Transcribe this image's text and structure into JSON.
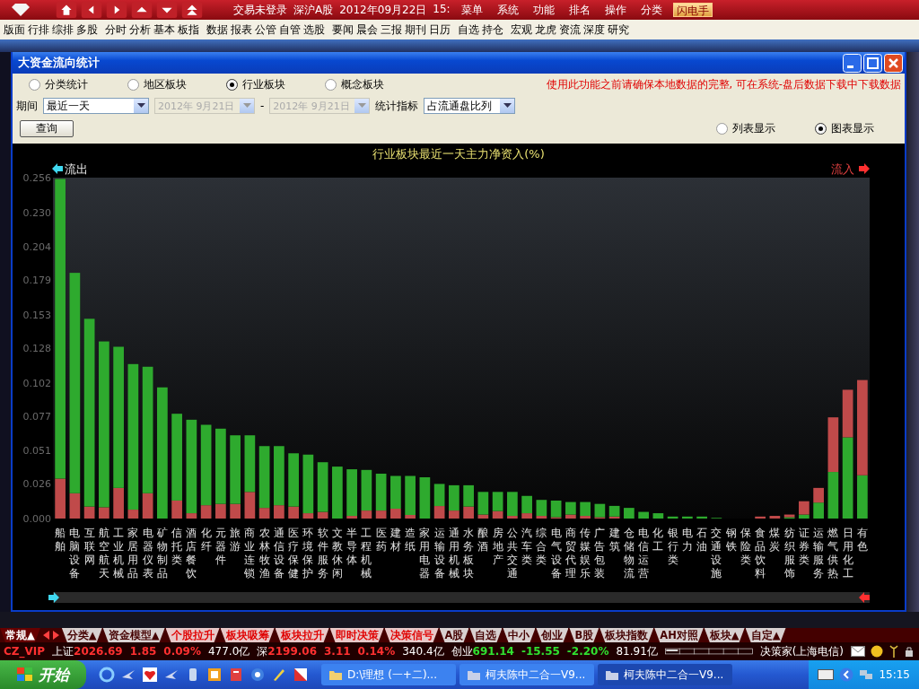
{
  "top_bar": {
    "status": [
      "交易未登录",
      "深沪A股",
      "2012年09月22日",
      "15:"
    ],
    "menus": [
      "菜单",
      "系统",
      "功能",
      "排名",
      "操作",
      "分类"
    ],
    "quick_button": "闪电手"
  },
  "toolbar": [
    [
      "版面",
      "行排",
      "综排",
      "多股"
    ],
    [
      "分时",
      "分析",
      "基本",
      "板指"
    ],
    [
      "数据",
      "报表",
      "公管",
      "自管",
      "选股"
    ],
    [
      "要闻",
      "晨会",
      "三报",
      "期刊",
      "日历"
    ],
    [
      "自选",
      "持仓"
    ],
    [
      "宏观",
      "龙虎",
      "资流",
      "深度",
      "研究"
    ]
  ],
  "dialog": {
    "title": "大资金流向统计",
    "categories": [
      {
        "label": "分类统计",
        "selected": false
      },
      {
        "label": "地区板块",
        "selected": false
      },
      {
        "label": "行业板块",
        "selected": true
      },
      {
        "label": "概念板块",
        "selected": false
      }
    ],
    "notice": "使用此功能之前请确保本地数据的完整, 可在系统-盘后数据下载中下载数据",
    "period_label": "期间",
    "period": "最近一天",
    "date_from": {
      "value": "2012年  9月21日",
      "disabled": true
    },
    "date_sep": "-",
    "date_to": {
      "value": "2012年  9月21日",
      "disabled": true
    },
    "indicator_label": "统计指标",
    "indicator": "占流通盘比列",
    "query_button": "查询",
    "outflow_label": "流出",
    "inflow_label": "流入",
    "views": [
      {
        "label": "列表显示",
        "selected": false
      },
      {
        "label": "图表显示",
        "selected": true
      }
    ],
    "chart_data": {
      "type": "bar",
      "title": "行业板块最近一天主力净资入(%)",
      "categories": [
        "船舶",
        "电脑设备",
        "互联网",
        "航空航天",
        "工业机械",
        "家居用品",
        "电器仪表",
        "矿物制品",
        "信托类",
        "酒店餐饮",
        "化纤",
        "元器件",
        "旅游",
        "商业连锁",
        "农林牧渔",
        "通信设备",
        "医疗保健",
        "环境保护",
        "软件服务",
        "文教休闲",
        "半导体",
        "工程机械",
        "医药",
        "建材",
        "造纸",
        "家用电器",
        "运输设备",
        "通用机械",
        "水务板块",
        "酿酒",
        "房地产",
        "公共交通",
        "汽车类",
        "综合类",
        "电气设备",
        "商贸代理",
        "传媒娱乐",
        "广告包装",
        "建筑",
        "仓储物流",
        "电信运营",
        "化工",
        "银行类",
        "电力",
        "石油",
        "交通设施",
        "钢铁",
        "保险类",
        "食品饮料",
        "煤炭",
        "纺织服饰",
        "证券类",
        "运输服务",
        "燃气供热",
        "日用化工",
        "有色"
      ],
      "stacked": true,
      "series": [
        {
          "color": "#2eaa2e",
          "values": [
            null,
            null,
            null,
            null,
            null,
            null,
            null,
            null,
            null,
            null,
            null,
            null,
            null,
            null,
            null,
            null,
            null,
            null,
            null,
            null,
            null,
            null,
            null,
            null,
            null,
            null,
            null,
            null,
            null,
            null,
            null,
            null,
            null,
            null,
            null,
            null,
            null,
            null,
            null,
            null,
            null,
            null,
            null,
            null,
            null,
            null,
            null,
            null,
            null,
            null,
            0.001,
            0.003,
            0.012,
            0.035,
            0.061,
            0.0325
          ]
        },
        {
          "color": "#c04a4a",
          "values": [
            0.03,
            0.019,
            0.009,
            0.0085,
            0.023,
            0.0067,
            0.019,
            0,
            0.0135,
            0.004,
            0.01,
            0.011,
            0.011,
            0.02,
            0.008,
            0.01,
            0.009,
            0.004,
            0.005,
            0,
            0.002,
            0.006,
            0.006,
            0.0074,
            0.0027,
            0,
            0.0094,
            0.006,
            0.009,
            0.003,
            0.0056,
            0.002,
            0.004,
            0.002,
            0.001,
            0.003,
            0.002,
            0.001,
            0.0015,
            0,
            0,
            0,
            0,
            0,
            0,
            0,
            0,
            0,
            0.0015,
            0.002,
            0.002,
            0.01,
            0.011,
            0.041,
            0.0357,
            0.0715
          ]
        },
        {
          "color": "#2eaa2e",
          "values": [
            0.225,
            0.1655,
            0.141,
            0.1245,
            0.106,
            0.1093,
            0.095,
            0.0985,
            0.0652,
            0.0702,
            0.0604,
            0.0565,
            0.0515,
            0.0425,
            0.0464,
            0.0444,
            0.04,
            0.044,
            0.0373,
            0.039,
            0.035,
            0.0305,
            0.0277,
            0.0246,
            0.0293,
            0.031,
            0.0166,
            0.019,
            0.016,
            0.017,
            0.0144,
            0.018,
            0.013,
            0.012,
            0.0125,
            0.0094,
            0.0104,
            0.01,
            0.008,
            0.008,
            0.005,
            0.004,
            0.0015,
            0.0015,
            0.0015,
            0.0005,
            0,
            0,
            null,
            null,
            null,
            null,
            null,
            null,
            null,
            null
          ]
        }
      ],
      "ylim": [
        0,
        0.256
      ],
      "yticks": [
        {
          "value": 0,
          "label": "0.000"
        },
        {
          "value": 0.026,
          "label": "0.026"
        },
        {
          "value": 0.051,
          "label": "0.051"
        },
        {
          "value": 0.077,
          "label": "0.077"
        },
        {
          "value": 0.102,
          "label": "0.102"
        },
        {
          "value": 0.128,
          "label": "0.128"
        },
        {
          "value": 0.153,
          "label": "0.153"
        },
        {
          "value": 0.179,
          "label": "0.179"
        },
        {
          "value": 0.204,
          "label": "0.204"
        },
        {
          "value": 0.23,
          "label": "0.230"
        },
        {
          "value": 0.256,
          "label": "0.256"
        }
      ]
    }
  },
  "bottom_tabs": [
    {
      "label": "常规▲",
      "kind": "normal",
      "selected": true
    },
    {
      "label": "分类▲",
      "kind": "normal",
      "selected": false
    },
    {
      "label": "资金模型▲",
      "kind": "normal",
      "selected": false
    },
    {
      "label": "个股拉升",
      "kind": "signal",
      "selected": false
    },
    {
      "label": "板块吸筹",
      "kind": "signal",
      "selected": false
    },
    {
      "label": "板块拉升",
      "kind": "signal",
      "selected": false
    },
    {
      "label": "即时决策",
      "kind": "signal",
      "selected": false
    },
    {
      "label": "决策信号",
      "kind": "signal",
      "selected": false
    },
    {
      "label": "A股",
      "kind": "normal",
      "selected": false
    },
    {
      "label": "自选",
      "kind": "normal",
      "selected": false
    },
    {
      "label": "中小",
      "kind": "normal",
      "selected": false
    },
    {
      "label": "创业",
      "kind": "normal",
      "selected": false
    },
    {
      "label": "B股",
      "kind": "normal",
      "selected": false
    },
    {
      "label": "板块指数",
      "kind": "normal",
      "selected": false
    },
    {
      "label": "AH对照",
      "kind": "normal",
      "selected": false
    },
    {
      "label": "板块▲",
      "kind": "normal",
      "selected": false
    },
    {
      "label": "自定▲",
      "kind": "normal",
      "selected": false
    }
  ],
  "status_bar": {
    "account": "CZ_VIP",
    "indices": [
      {
        "name": "上证",
        "value": "2026.69",
        "change": "1.85",
        "percent": "0.09%",
        "amount": "477.0亿",
        "color": "#ff3030"
      },
      {
        "name": "深",
        "value": "2199.06",
        "change": "3.11",
        "percent": "0.14%",
        "amount": "340.4亿",
        "color": "#ff3030"
      },
      {
        "name": "创业",
        "value": "691.14",
        "change": "-15.55",
        "percent": "-2.20%",
        "amount": "81.91亿",
        "color": "#30e030"
      }
    ],
    "server": "决策家(上海电信)"
  },
  "taskbar": {
    "start": "开始",
    "tasks": [
      {
        "label": "D:\\理想 (一+二)...",
        "selected": false
      },
      {
        "label": "柯夫陈中二合一V9...",
        "selected": false
      },
      {
        "label": "柯夫陈中二合一V9...",
        "selected": true
      }
    ],
    "clock": "15:15"
  }
}
